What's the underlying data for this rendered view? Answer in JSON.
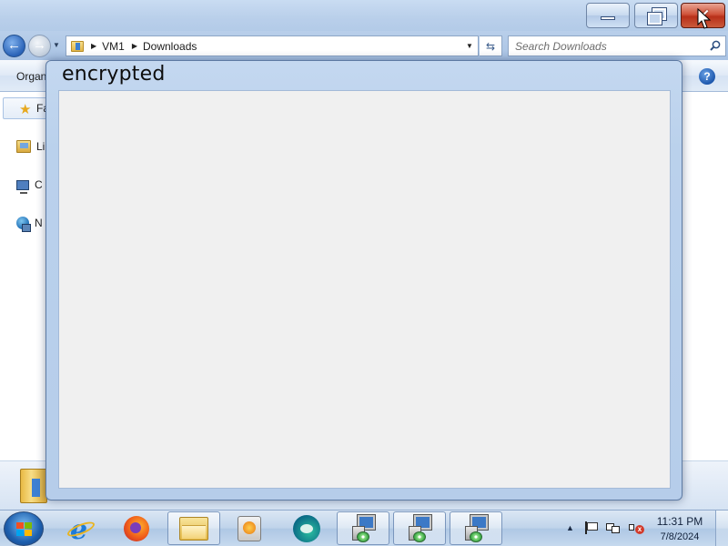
{
  "explorer": {
    "address": {
      "crumbs": [
        "VM1",
        "Downloads"
      ]
    },
    "search": {
      "placeholder": "Search Downloads"
    },
    "command_bar": {
      "organize_label": "Organ"
    },
    "nav_pane": {
      "favorites_label": "Fa",
      "items": [
        {
          "label": "Li",
          "icon": "libraries-icon"
        },
        {
          "label": "C",
          "icon": "computer-icon"
        },
        {
          "label": "N",
          "icon": "network-icon"
        }
      ]
    }
  },
  "dialog": {
    "title": "encrypted"
  },
  "taskbar": {
    "pinned": [
      {
        "name": "internet-explorer-icon"
      },
      {
        "name": "firefox-icon"
      },
      {
        "name": "windows-explorer-icon",
        "active": true
      },
      {
        "name": "media-player-icon"
      },
      {
        "name": "edge-icon"
      },
      {
        "name": "setup-installer-icon"
      },
      {
        "name": "setup-installer-icon"
      },
      {
        "name": "setup-installer-icon"
      }
    ],
    "clock": {
      "time": "11:31 PM",
      "date": "7/8/2024"
    }
  },
  "colors": {
    "close_button": "#c8462f",
    "dialog_frame": "#bad1ec",
    "dialog_client": "#f0f0f0",
    "taskbar": "#bfd3ea"
  }
}
